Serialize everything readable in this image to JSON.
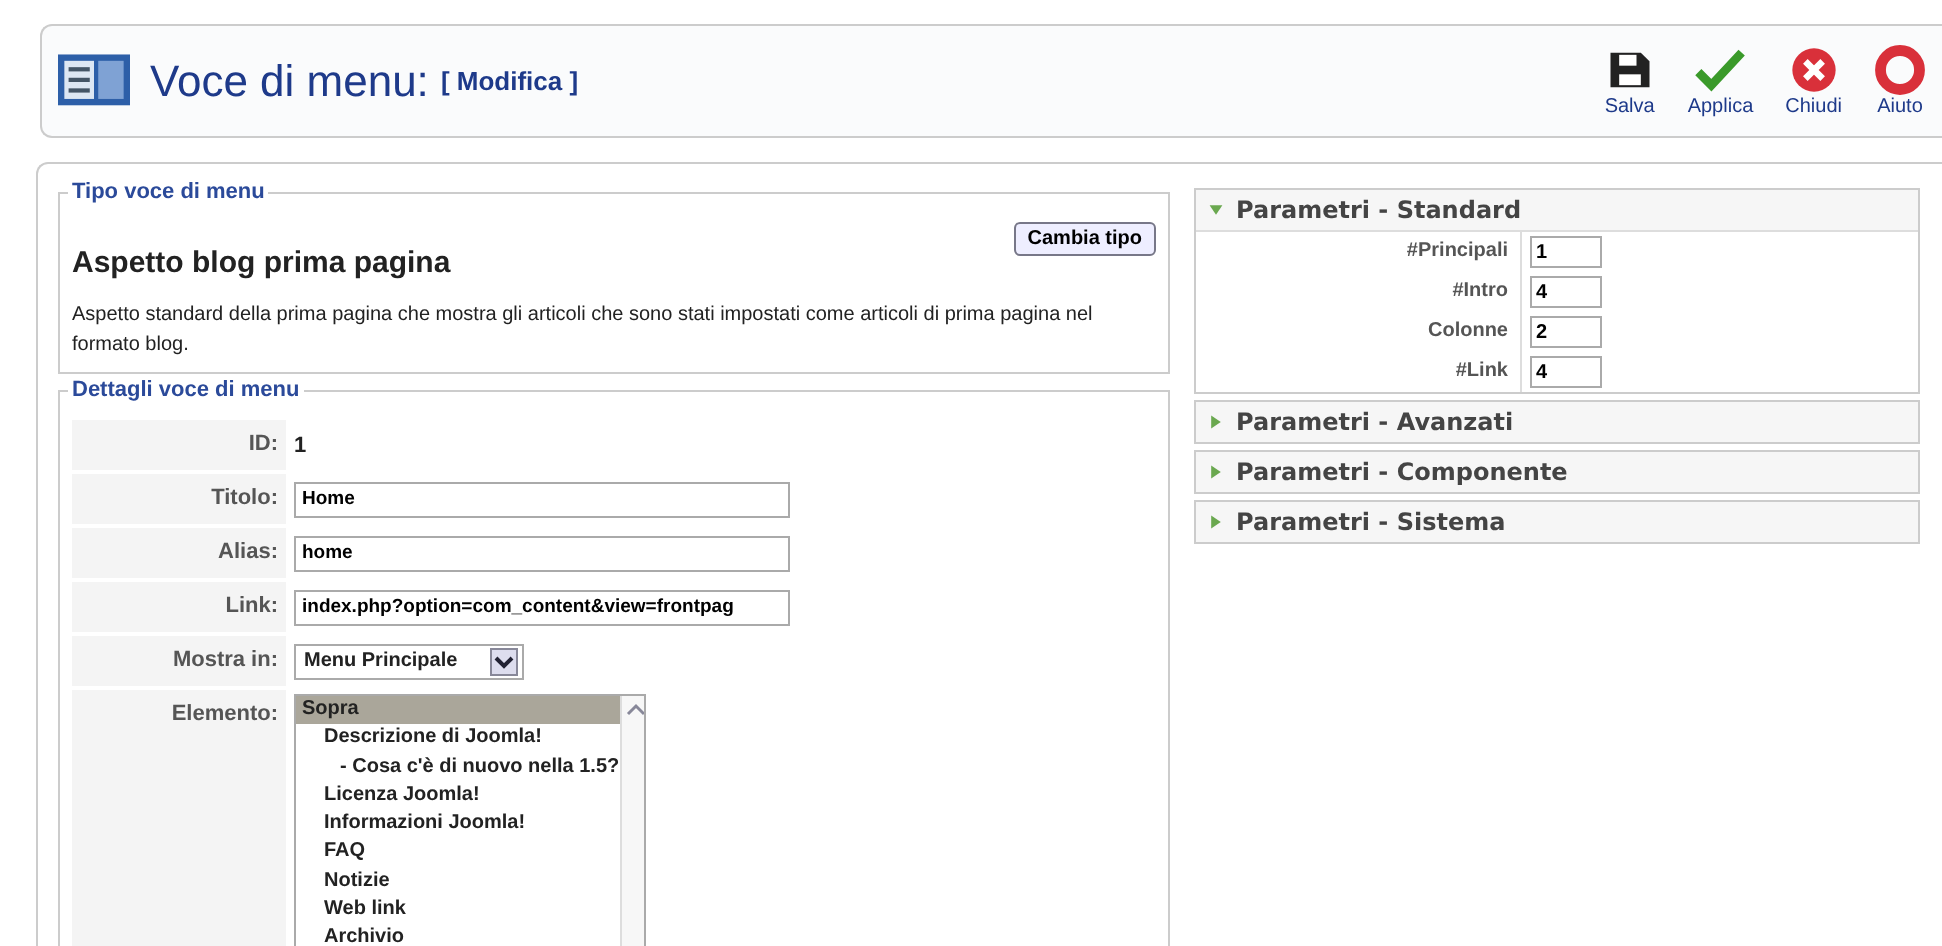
{
  "header": {
    "title": "Voce di menu:",
    "subtitle": "[ Modifica ]"
  },
  "toolbar": [
    {
      "kind": "save",
      "label": "Salva"
    },
    {
      "kind": "apply",
      "label": "Applica"
    },
    {
      "kind": "close",
      "label": "Chiudi"
    },
    {
      "kind": "help",
      "label": "Aiuto"
    }
  ],
  "type_box": {
    "legend": "Tipo voce di menu",
    "button": "Cambia tipo",
    "heading": "Aspetto blog prima pagina",
    "description": "Aspetto standard della prima pagina che mostra gli articoli che sono stati impostati come articoli di prima pagina nel formato blog."
  },
  "details": {
    "legend": "Dettagli voce di menu",
    "id_label": "ID:",
    "id_value": "1",
    "fields": [
      {
        "label": "Titolo:",
        "value": "Home"
      },
      {
        "label": "Alias:",
        "value": "home"
      },
      {
        "label": "Link:",
        "value": "index.php?option=com_content&view=frontpag"
      }
    ],
    "show_in": {
      "label": "Mostra in:",
      "value": "Menu Principale"
    },
    "element": {
      "label": "Elemento:",
      "items": [
        {
          "label": "Sopra",
          "selected": true
        },
        {
          "label": "Descrizione di Joomla!",
          "selected": false,
          "children": [
            {
              "label": "- Cosa c'è di nuovo nella 1.5?",
              "selected": false
            }
          ]
        },
        {
          "label": "Licenza Joomla!",
          "selected": false
        },
        {
          "label": "Informazioni Joomla!",
          "selected": false
        },
        {
          "label": "FAQ",
          "selected": false
        },
        {
          "label": "Notizie",
          "selected": false
        },
        {
          "label": "Web link",
          "selected": false
        },
        {
          "label": "Archivio",
          "selected": false
        }
      ]
    }
  },
  "params": [
    {
      "title": "Parametri - Standard",
      "expanded": true,
      "fields": [
        {
          "label": "#Principali",
          "value": "1"
        },
        {
          "label": "#Intro",
          "value": "4"
        },
        {
          "label": "Colonne",
          "value": "2"
        },
        {
          "label": "#Link",
          "value": "4"
        }
      ]
    },
    {
      "title": "Parametri - Avanzati",
      "expanded": false
    },
    {
      "title": "Parametri - Componente",
      "expanded": false
    },
    {
      "title": "Parametri - Sistema",
      "expanded": false
    }
  ]
}
